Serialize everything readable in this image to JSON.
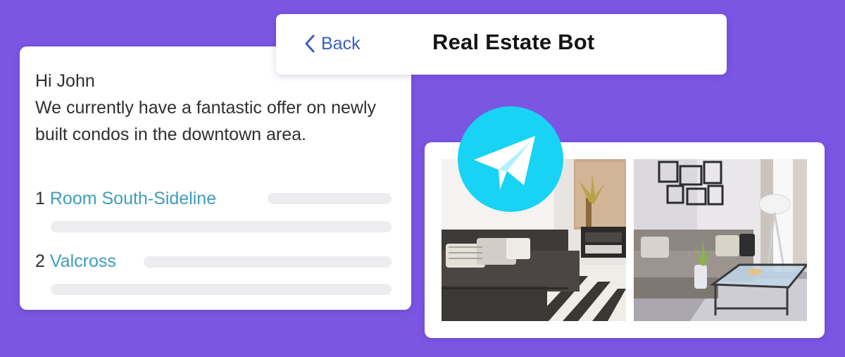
{
  "header": {
    "back_label": "Back",
    "title": "Real Estate Bot"
  },
  "message": {
    "greeting": "Hi John",
    "body": "We currently have a fantastic offer on newly built condos in the downtown area.",
    "listings": [
      {
        "number": "1",
        "name": "Room South-Sideline"
      },
      {
        "number": "2",
        "name": "Valcross"
      }
    ]
  },
  "icons": {
    "back": "chevron-left-icon",
    "badge": "telegram-icon"
  },
  "images": [
    {
      "name": "living-room-photo-1",
      "subject": "living room with dark sofa and striped rug"
    },
    {
      "name": "living-room-photo-2",
      "subject": "living room with beige sofa and glass coffee table"
    }
  ],
  "colors": {
    "background": "#7b56e3",
    "link": "#3d9dbd",
    "back_button": "#3a5fc8",
    "telegram_badge": "#19d3f5"
  }
}
